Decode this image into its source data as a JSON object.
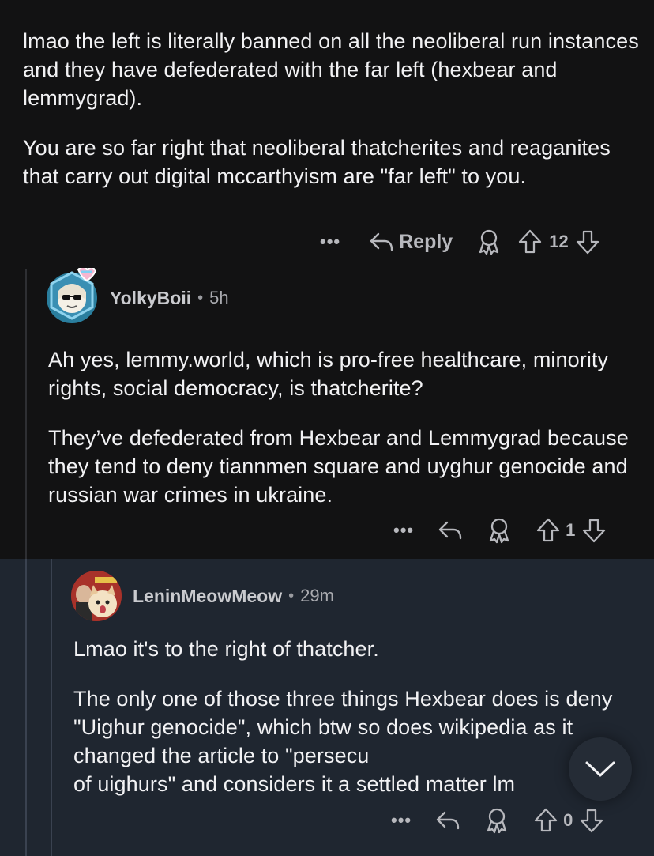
{
  "comment1": {
    "paragraphs": [
      "lmao the left is literally banned on all the neoliberal run instances and they have defederated with the far left (hexbear and lemmygrad).",
      "You are so far right that neoliberal thatcherites and reaganites that carry out digital mccarthyism are \"far left\" to you."
    ],
    "actions": {
      "more": "•••",
      "reply_label": "Reply",
      "score": "12"
    }
  },
  "comment2": {
    "username": "YolkyBoii",
    "separator": "•",
    "time": "5h",
    "paragraphs": [
      "Ah yes, lemmy.world, which is pro-free healthcare, minority rights, social democracy, is thatcherite?",
      "They’ve defederated from Hexbear and Lemmygrad because they tend to deny tiannmen square and uyghur genocide and russian war crimes in ukraine."
    ],
    "actions": {
      "more": "•••",
      "score": "1"
    }
  },
  "comment3": {
    "username": "LeninMeowMeow",
    "separator": "•",
    "time": "29m",
    "paragraphs": [
      "Lmao it's to the right of thatcher.",
      "The only one of those three things Hexbear does is deny \"Uighur genocide\", which btw so does wikipedia as it changed the article to \"persecu",
      "of uighurs\" and considers it a settled matter lm"
    ],
    "actions": {
      "more": "•••",
      "score": "0"
    }
  },
  "colors": {
    "background": "#121213",
    "highlight": "#1f2630",
    "text": "#f2f2f4",
    "muted": "#b7b8bd"
  },
  "icons": [
    "reply-icon",
    "award-icon",
    "upvote-icon",
    "downvote-icon",
    "chevron-down-icon",
    "more-icon"
  ]
}
